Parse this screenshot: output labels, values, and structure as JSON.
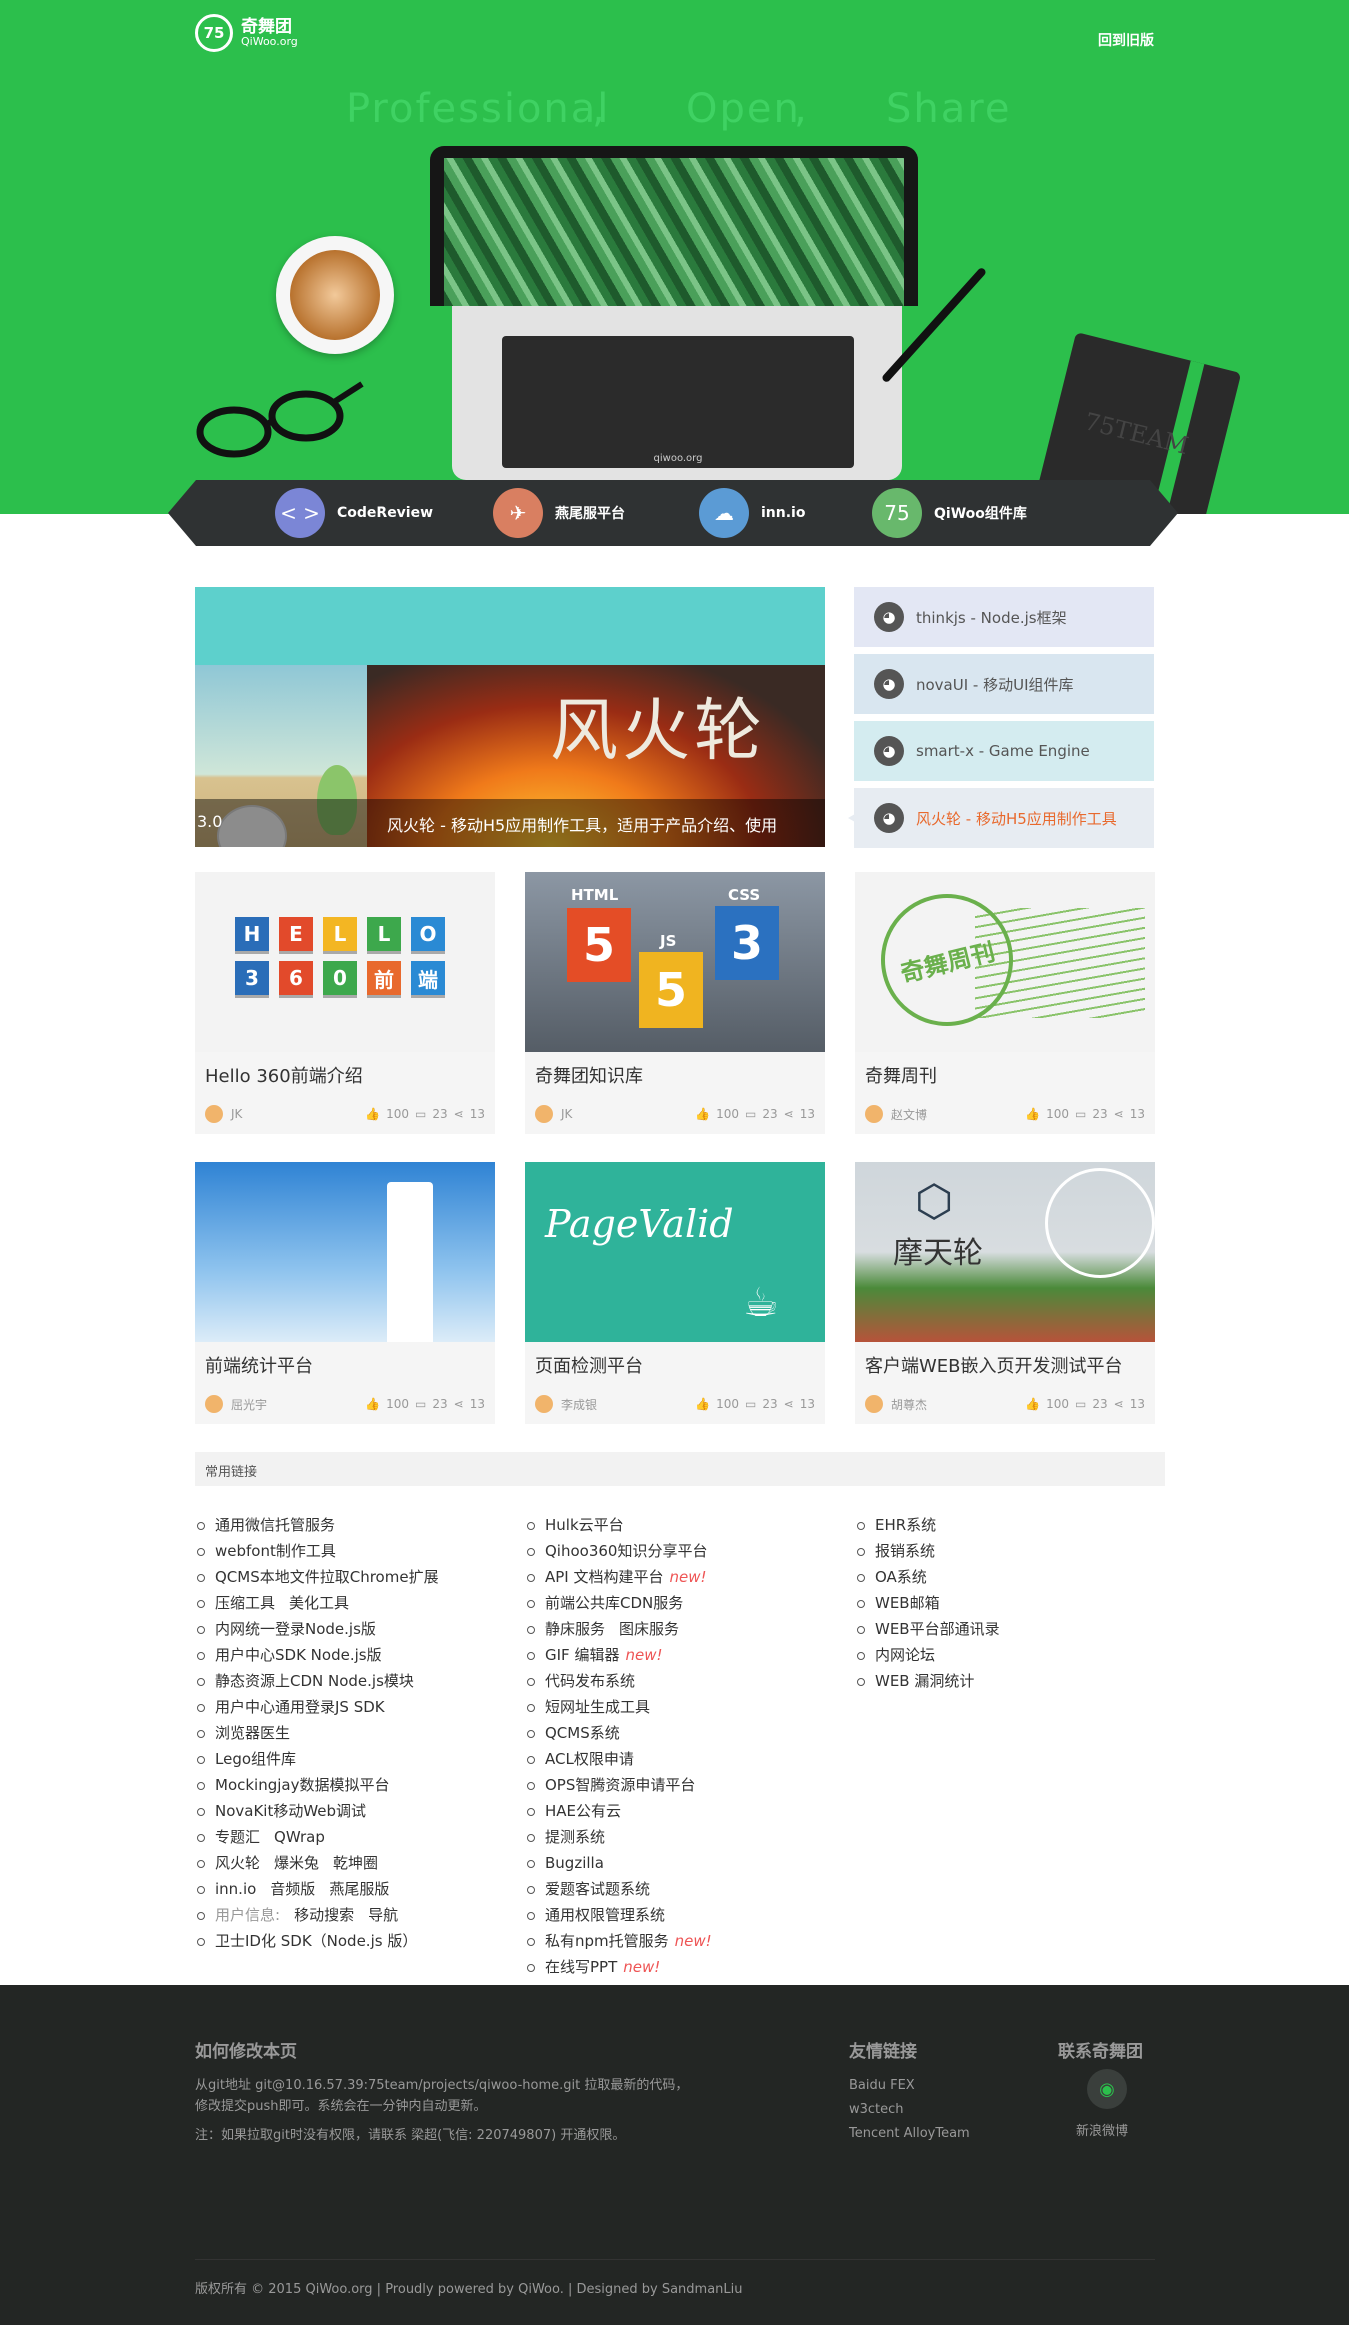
{
  "header": {
    "logo_mark": "75",
    "logo_name": "奇舞团",
    "logo_site": "QiWoo.org",
    "back_old": "回到旧版"
  },
  "hero": {
    "slogan_1": "Professional",
    "sep_1": ",",
    "slogan_2": "Open",
    "sep_2": ",",
    "slogan_3": "Share",
    "laptop_label": "qiwoo.org",
    "notebook_text": "75TEAM"
  },
  "quicknav": [
    {
      "label": "CodeReview",
      "icon": "code-icon",
      "glyph": "< >",
      "color": "#7b86d6"
    },
    {
      "label": "燕尾服平台",
      "icon": "swallow-icon",
      "glyph": "✈",
      "color": "#d97f61"
    },
    {
      "label": "inn.io",
      "icon": "cloud-icon",
      "glyph": "☁",
      "color": "#5b9bd5"
    },
    {
      "label": "QiWoo组件库",
      "icon": "qiwoo-75-icon",
      "glyph": "75",
      "color": "#68b86c"
    }
  ],
  "slider": {
    "left_caption": "3.0",
    "right_caption": "风火轮 - 移动H5应用制作工具，适用于产品介绍、使用",
    "fire_title": "风火轮"
  },
  "github_list": [
    {
      "label": "thinkjs - Node.js框架",
      "bg": "#e3e7f4",
      "color": "#555"
    },
    {
      "label": "novaUI - 移动UI组件库",
      "bg": "#d9e6f0",
      "color": "#555"
    },
    {
      "label": "smart-x - Game Engine",
      "bg": "#d4ecf0",
      "color": "#555"
    },
    {
      "label": "风火轮 - 移动H5应用制作工具",
      "bg": "#e7ecf2",
      "color": "#e8692d"
    }
  ],
  "cards": [
    {
      "title": "Hello 360前端介绍",
      "author": "JK",
      "likes": "100",
      "comments": "23",
      "shares": "13"
    },
    {
      "title": "奇舞团知识库",
      "author": "JK",
      "likes": "100",
      "comments": "23",
      "shares": "13",
      "html_label": "HTML",
      "js_label": "JS",
      "css_label": "CSS"
    },
    {
      "title": "奇舞周刊",
      "author": "赵文博",
      "likes": "100",
      "comments": "23",
      "shares": "13",
      "stamp_text": "奇舞周刊"
    },
    {
      "title": "前端统计平台",
      "author": "屈光宇",
      "likes": "100",
      "comments": "23",
      "shares": "13"
    },
    {
      "title": "页面检测平台",
      "author": "李成银",
      "likes": "100",
      "comments": "23",
      "shares": "13",
      "pv_text": "PageValid"
    },
    {
      "title": "客户端WEB嵌入页开发测试平台",
      "author": "胡尊杰",
      "likes": "100",
      "comments": "23",
      "shares": "13",
      "mtl_text": "摩天轮"
    }
  ],
  "hello_tiles": {
    "row1": [
      "H",
      "E",
      "L",
      "L",
      "O"
    ],
    "row2": [
      "3",
      "6",
      "0",
      "前",
      "端"
    ]
  },
  "links_header": "常用链接",
  "links": {
    "col1": [
      [
        "通用微信托管服务"
      ],
      [
        "webfont制作工具"
      ],
      [
        "QCMS本地文件拉取Chrome扩展"
      ],
      [
        "压缩工具",
        "美化工具"
      ],
      [
        "内网统一登录Node.js版"
      ],
      [
        "用户中心SDK Node.js版"
      ],
      [
        "静态资源上CDN Node.js模块"
      ],
      [
        "用户中心通用登录JS SDK"
      ],
      [
        "浏览器医生"
      ],
      [
        "Lego组件库"
      ],
      [
        "Mockingjay数据模拟平台"
      ],
      [
        "NovaKit移动Web调试"
      ],
      [
        "专题汇",
        "QWrap"
      ],
      [
        "风火轮",
        "爆米兔",
        "乾坤圈"
      ],
      [
        "inn.io",
        "音频版",
        "燕尾服版"
      ],
      [
        "用户信息:",
        "移动搜索",
        "导航"
      ],
      [
        "卫士ID化 SDK（Node.js 版）"
      ]
    ],
    "col2": [
      [
        "Hulk云平台"
      ],
      [
        "Qihoo360知识分享平台"
      ],
      [
        "API 文档构建平台"
      ],
      [
        "前端公共库CDN服务"
      ],
      [
        "静床服务",
        "图床服务"
      ],
      [
        "GIF 编辑器"
      ],
      [
        "代码发布系统"
      ],
      [
        "短网址生成工具"
      ],
      [
        "QCMS系统"
      ],
      [
        "ACL权限申请"
      ],
      [
        "OPS智腾资源申请平台"
      ],
      [
        "HAE公有云"
      ],
      [
        "提测系统"
      ],
      [
        "Bugzilla"
      ],
      [
        "爱题客试题系统"
      ],
      [
        "通用权限管理系统"
      ],
      [
        "私有npm托管服务"
      ],
      [
        "在线写PPT"
      ]
    ],
    "col3": [
      [
        "EHR系统"
      ],
      [
        "报销系统"
      ],
      [
        "OA系统"
      ],
      [
        "WEB邮箱"
      ],
      [
        "WEB平台部通讯录"
      ],
      [
        "内网论坛"
      ],
      [
        "WEB 漏洞统计"
      ]
    ],
    "new_label": "new!"
  },
  "footer": {
    "how_title": "如何修改本页",
    "how_p1": "从git地址 git@10.16.57.39:75team/projects/qiwoo-home.git 拉取最新的代码，",
    "how_p2": "修改提交push即可。系统会在一分钟内自动更新。",
    "how_note": "注：如果拉取git时没有权限，请联系 梁超(飞信: 220749807) 开通权限。",
    "friends_title": "友情链接",
    "friends": [
      "Baidu FEX",
      "w3ctech",
      "Tencent AlloyTeam"
    ],
    "contact_title": "联系奇舞团",
    "weibo_label": "新浪微博",
    "copyright": "版权所有 © 2015 QiWoo.org | Proudly powered by QiWoo. | Designed by SandmanLiu"
  }
}
